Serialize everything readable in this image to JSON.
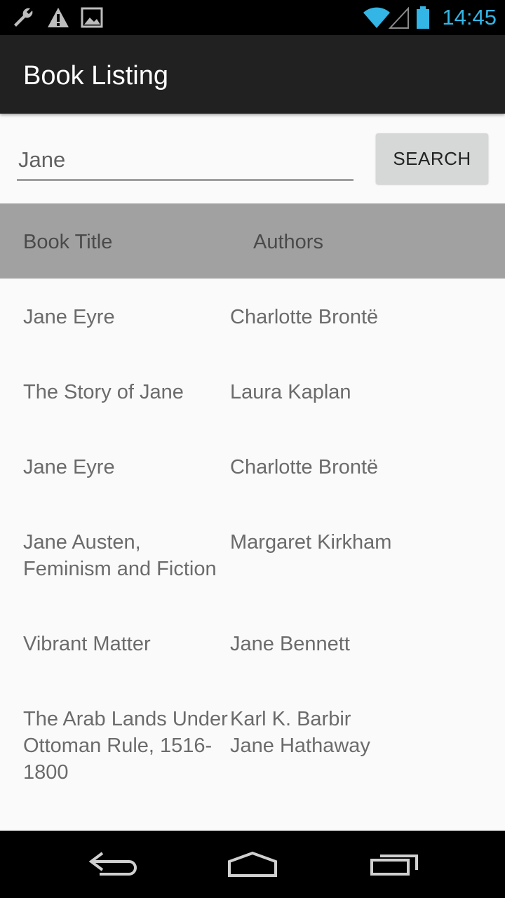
{
  "status_bar": {
    "time": "14:45",
    "left_icons": [
      "wrench-icon",
      "warning-icon",
      "image-icon"
    ],
    "right_icons": [
      "wifi-icon",
      "signal-icon",
      "battery-icon"
    ],
    "time_color": "#33b5e5"
  },
  "app_bar": {
    "title": "Book Listing"
  },
  "search": {
    "value": "Jane",
    "button_label": "SEARCH"
  },
  "table": {
    "headers": {
      "title": "Book Title",
      "authors": "Authors"
    },
    "rows": [
      {
        "title": "Jane Eyre",
        "authors": [
          "Charlotte Brontë"
        ]
      },
      {
        "title": "The Story of Jane",
        "authors": [
          "Laura Kaplan"
        ]
      },
      {
        "title": "Jane Eyre",
        "authors": [
          "Charlotte Brontë"
        ]
      },
      {
        "title": "Jane Austen, Feminism and Fiction",
        "authors": [
          "Margaret Kirkham"
        ]
      },
      {
        "title": "Vibrant Matter",
        "authors": [
          "Jane Bennett"
        ]
      },
      {
        "title": "The Arab Lands Under Ottoman Rule, 1516-1800",
        "authors": [
          "Karl K. Barbir",
          "Jane Hathaway"
        ]
      }
    ]
  },
  "nav_bar": {
    "buttons": [
      "back-icon",
      "home-icon",
      "recent-apps-icon"
    ]
  }
}
